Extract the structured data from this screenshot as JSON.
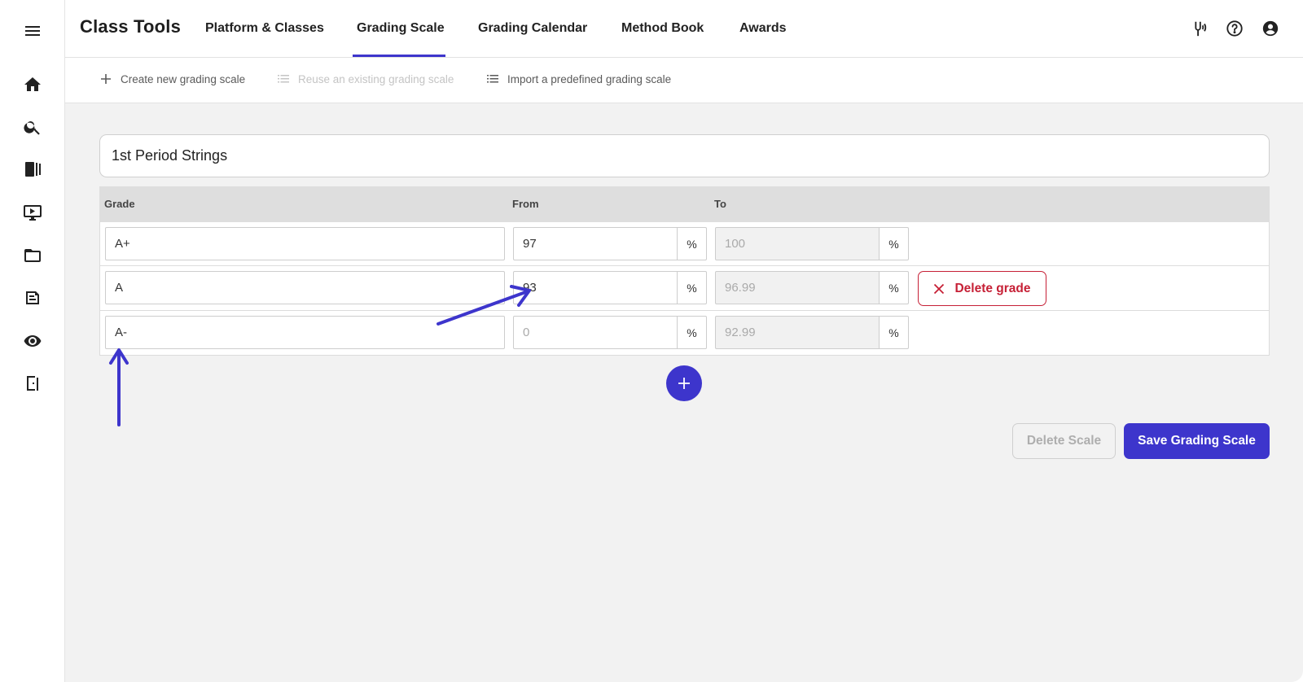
{
  "header": {
    "title": "Class Tools",
    "tabs": [
      {
        "label": "Platform & Classes"
      },
      {
        "label": "Grading Scale",
        "active": true
      },
      {
        "label": "Grading Calendar"
      },
      {
        "label": "Method Book"
      },
      {
        "label": "Awards"
      }
    ],
    "icons": [
      "tuning-fork-icon",
      "help-icon",
      "account-icon"
    ]
  },
  "rail": {
    "icons": [
      "menu-icon",
      "home-icon",
      "search-icon",
      "library-icon",
      "video-icon",
      "folder-icon",
      "assignment-icon",
      "view-icon",
      "exit-icon"
    ]
  },
  "actions": {
    "create_label": "Create new grading scale",
    "reuse_label": "Reuse an existing grading scale",
    "import_label": "Import a predefined grading scale"
  },
  "scale": {
    "name": "1st Period Strings"
  },
  "table": {
    "headers": {
      "grade": "Grade",
      "from": "From",
      "to": "To"
    },
    "percent_sign": "%",
    "rows": [
      {
        "grade": "A+",
        "from": "97",
        "to": "100"
      },
      {
        "grade": "A",
        "from": "93",
        "to": "96.99"
      },
      {
        "grade": "A-",
        "from": "0",
        "to": "92.99"
      }
    ],
    "delete_grade_label": "Delete grade"
  },
  "buttons": {
    "delete_scale": "Delete Scale",
    "save_scale": "Save Grading Scale"
  },
  "colors": {
    "accent": "#3d35cc",
    "danger": "#c62036",
    "background": "#f2f2f2"
  }
}
